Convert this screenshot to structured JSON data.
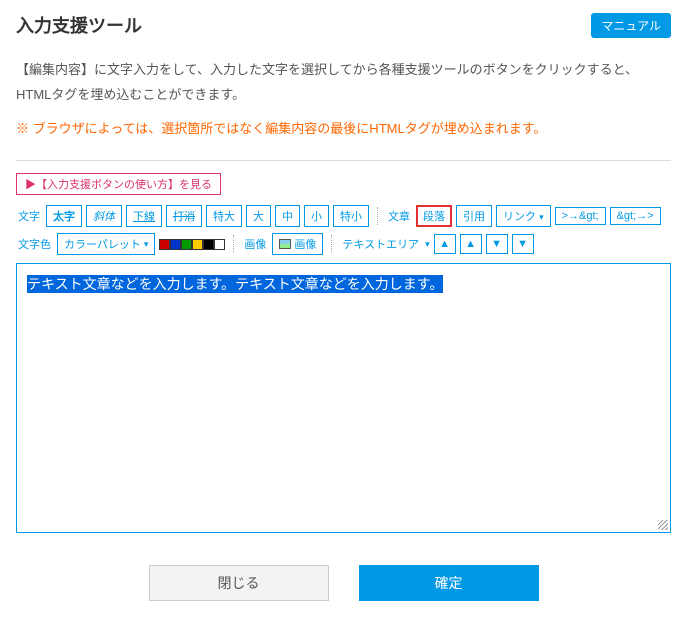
{
  "header": {
    "title": "入力支援ツール",
    "manual": "マニュアル"
  },
  "description": "【編集内容】に文字入力をして、入力した文字を選択してから各種支援ツールのボタンをクリックすると、\nHTMLタグを埋め込むことができます。",
  "warning": "※ ブラウザによっては、選択箇所ではなく編集内容の最後にHTMLタグが埋め込まれます。",
  "usage_link": {
    "prefix": "▶【入力支援ボタンの使い方】",
    "suffix": "を見る"
  },
  "toolbar": {
    "row1": {
      "label1": "文字",
      "bold": "太字",
      "italic": "斜体",
      "underline": "下線",
      "strike": "打消",
      "xlarge": "特大",
      "large": "大",
      "medium": "中",
      "small": "小",
      "xsmall": "特小",
      "label2": "文章",
      "paragraph": "段落",
      "quote": "引用",
      "link": "リンク",
      "gt1": ">→&gt;",
      "gt2": "&gt;→>"
    },
    "row2": {
      "label1": "文字色",
      "palette": "カラーパレット",
      "swatches": [
        "#cc0000",
        "#0033cc",
        "#009900",
        "#ffcc00",
        "#000000",
        "#ffffff"
      ],
      "label2": "画像",
      "image_btn": "画像",
      "label3": "テキストエリア",
      "arrows": [
        "▲",
        "▲",
        "▼",
        "▼"
      ]
    }
  },
  "editor": {
    "text": "テキスト文章などを入力します。テキスト文章などを入力します。"
  },
  "footer": {
    "close": "閉じる",
    "confirm": "確定"
  }
}
